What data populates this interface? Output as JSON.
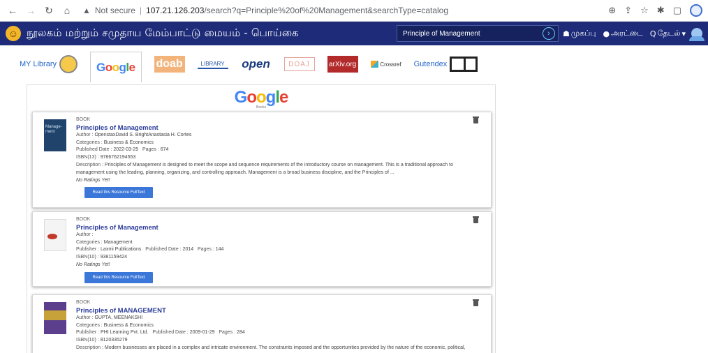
{
  "browser": {
    "url_warning": "Not secure",
    "url_host": "107.21.126.203",
    "url_path": "/search?q=Principle%20of%20Management&searchType=catalog"
  },
  "header": {
    "title": "நூலகம் மற்றும் சமுதாய மேம்பாட்டு மையம் - பொய்கை",
    "search_value": "Principle of Management",
    "menu": {
      "home": "முகப்பு",
      "chat": "அரட்டை",
      "search": "தேடல்"
    }
  },
  "source_tabs": {
    "my_library": "MY Library",
    "google": "Google",
    "doab": "doab",
    "library": "LIBRARY",
    "open": "open",
    "doaj": "DOAJ",
    "arxiv": "arXiv.org",
    "crossref": "Crossref",
    "gutendex": "Gutendex"
  },
  "panel": {
    "brand": "Google",
    "brand_sub": "Books"
  },
  "results": [
    {
      "type": "BOOK",
      "title": "Principles of Management",
      "author_label": "Author :",
      "author": "OpenstaxDavid S. BrightAnastasia H. Cortes",
      "categories_label": "Categories :",
      "categories": "Business & Economics",
      "published_label": "Published Date :",
      "published": "2022-03-25",
      "pages_label": "Pages :",
      "pages": "674",
      "isbn_label": "ISBN(13) :",
      "isbn": "9786762194553",
      "description_label": "Description :",
      "description": "Principles of Management is designed to meet the scope and sequence requirements of the introductory course on management. This is a traditional approach to management using the leading, planning, organizing, and controlling approach. Management is a broad business discipline, and the Principles of ...",
      "rating": "No Ratings Yet!",
      "button": "Read this Resource FullText",
      "cover_text": "Manage-ment"
    },
    {
      "type": "BOOK",
      "title": "Principles of Management",
      "author_label": "Author :",
      "author": "",
      "categories_label": "Categories :",
      "categories": "Management",
      "publisher_label": "Publisher :",
      "publisher": "Laxmi Publications",
      "published_label": "Published Date :",
      "published": "2014",
      "pages_label": "Pages :",
      "pages": "144",
      "isbn_label": "ISBN(10) :",
      "isbn": "9381159424",
      "rating": "No Ratings Yet!",
      "button": "Read this Resource FullText"
    },
    {
      "type": "BOOK",
      "title": "Principles of MANAGEMENT",
      "author_label": "Author :",
      "author": "GUPTA, MEENAKSHI",
      "categories_label": "Categories :",
      "categories": "Business & Economics",
      "publisher_label": "Publisher :",
      "publisher": "PHI Learning Pvt. Ltd.",
      "published_label": "Published Date :",
      "published": "2009-01-29",
      "pages_label": "Pages :",
      "pages": "284",
      "isbn_label": "ISBN(10) :",
      "isbn": "8120335279",
      "description_label": "Description :",
      "description": "Modern businesses are placed in a complex and intricate environment. The constraints imposed and the opportunities provided by the nature of the economic, political, legal,"
    }
  ]
}
